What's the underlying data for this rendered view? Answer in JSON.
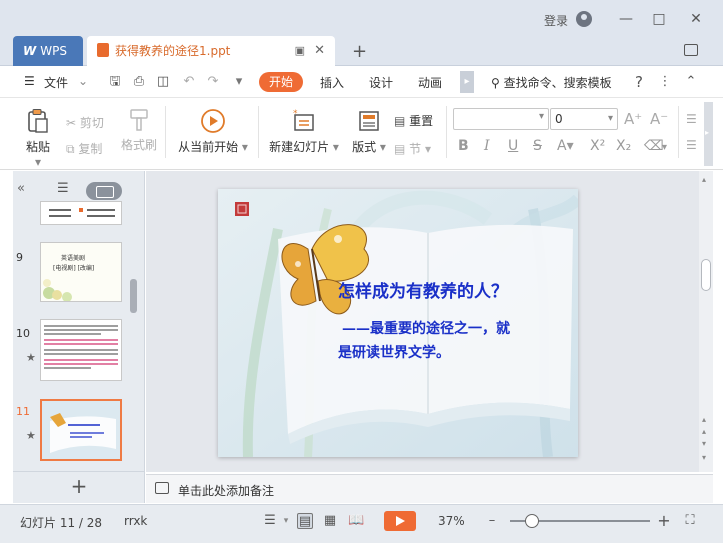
{
  "window": {
    "login_label": "登录"
  },
  "tabs": {
    "app_tab_label": "WPS",
    "document_tab_label": "获得教养的途径1.ppt"
  },
  "menu": {
    "file_label": "文件",
    "items": [
      "开始",
      "插入",
      "设计",
      "动画"
    ],
    "search_label": "查找命令、搜索模板"
  },
  "ribbon": {
    "paste_label": "粘贴",
    "cut_label": "剪切",
    "copy_label": "复制",
    "format_painter_label": "格式刷",
    "play_from_current_label": "从当前开始",
    "new_slide_label": "新建幻灯片",
    "layout_label": "版式",
    "reset_label": "重置",
    "section_label": "节",
    "font_size_value": "0"
  },
  "slide_panel": {
    "thumbnails": [
      {
        "number": "9",
        "title": "英语美剧",
        "subtitle": "[电视剧] [改编]"
      },
      {
        "number": "10",
        "text": "文字内容说明"
      },
      {
        "number": "11",
        "text": "怎样成为有教养的人？"
      }
    ]
  },
  "slide": {
    "title": "怎样成为有教养的人？",
    "body_line1": "——最重要的途径之一，就",
    "body_line2": "是研读世界文学。"
  },
  "notes": {
    "placeholder": "单击此处添加备注"
  },
  "status": {
    "slide_counter": "幻灯片 11 / 28",
    "author": "rrxk",
    "zoom_level": "37%"
  },
  "colors": {
    "accent_orange": "#ef6b34",
    "slide_title_blue": "#1a30c8"
  }
}
